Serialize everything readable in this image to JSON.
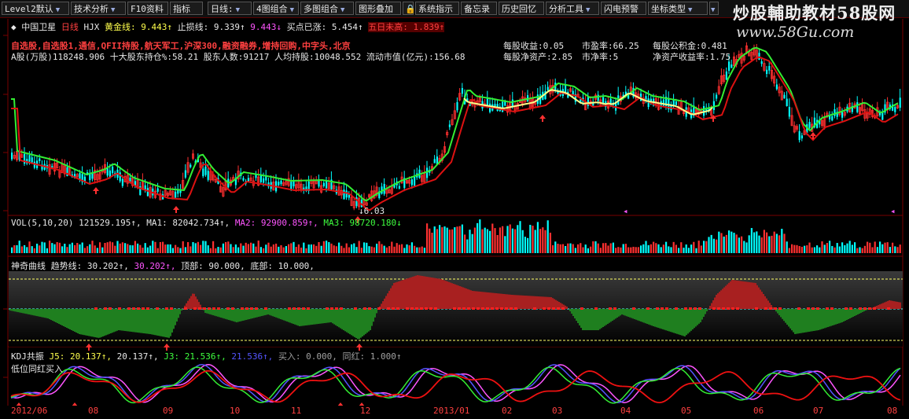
{
  "toolbar": {
    "items": [
      "Level2默认",
      "技术分析",
      "F10资料",
      "指标",
      "日线:",
      "4图组合",
      "多图组合",
      "图形叠加",
      "系统指示",
      "备忘录",
      "历史回忆",
      "分析工具",
      "闪电预警",
      "坐标类型"
    ],
    "lock_icon": "lock-icon"
  },
  "watermark": {
    "title": "炒股輔助教材58股网",
    "url": "www.58Gu.com"
  },
  "main": {
    "stock_name": "中国卫星",
    "period": "日线",
    "indicator": "HJX",
    "gold_line": "黄金线: 9.443↑",
    "stop_line": "止损线: 9.339↑",
    "val3": "9.443↓",
    "buy_gain": "买点已涨: 5.454↑",
    "five_day": "五日未高: 1.839↑",
    "tags_line": "自选股,自选股1,通信,QFII持股,航天军工,沪深300,融资融券,增持回购,中字头,北京",
    "shares_line": "A股(万股)118248.906  十大股东持仓%:58.21    股东人数:91217    人均持股:10048.552  流动市值(亿元):156.68",
    "eps": "每股收益:0.05",
    "pe": "市盈率:66.25",
    "reserve": "每股公积金:0.481",
    "navps": "每股净资产:2.85",
    "pb": "市净率:5",
    "roe": "净资产收益率:1.75",
    "price_note": "6.03",
    "price_note_mark": "↓",
    "marker_glyph": "◂"
  },
  "vol": {
    "title": "VOL(5,10,20)",
    "v": "121529.195↑,",
    "ma1": "MA1: 82042.734↑,",
    "ma2": "MA2: 92900.859↑,",
    "ma3": "MA3: 98720.180↓"
  },
  "shenqi": {
    "title": "神奇曲线",
    "trend": "趋势线: 30.202↑,",
    "v2": "30.202↑,",
    "top": "顶部: 90.000,",
    "bottom": "底部: 10.000,"
  },
  "kdj": {
    "title": "KDJ共振",
    "j5": "J5: 20.137↑,",
    "v2": "20.137↑,",
    "j3": "J3: 21.536↑,",
    "v4": "21.536↑,",
    "buy": "买入: 0.000,",
    "red": "同红: 1.000↑",
    "subtitle": "低位同红买入"
  },
  "xaxis": [
    "2012/06",
    "08",
    "09",
    "10",
    "11",
    "12",
    "2013/01",
    "02",
    "03",
    "04",
    "05",
    "06",
    "07",
    "08"
  ],
  "colors": {
    "up": "#ff3030",
    "down": "#00ffff",
    "gold": "#ffff66",
    "green": "#33dd33",
    "dark_red": "#7a0000"
  }
}
